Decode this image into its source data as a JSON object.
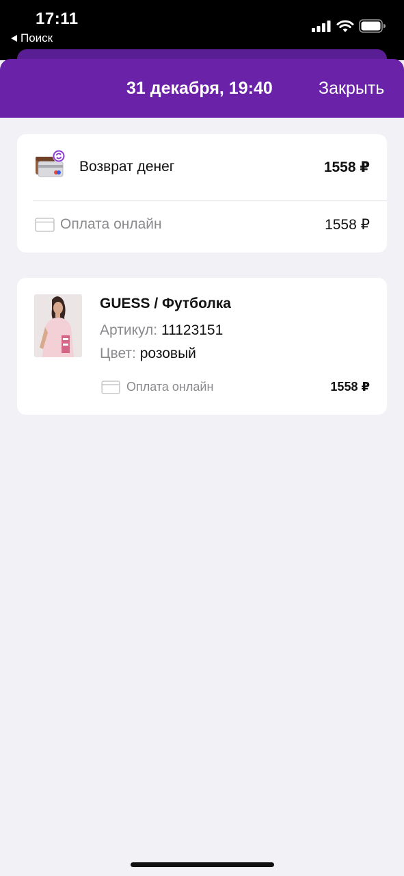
{
  "status_bar": {
    "time": "17:11",
    "back_label": "Поиск",
    "icons": [
      "signal-icon",
      "wifi-icon",
      "battery-icon"
    ]
  },
  "header": {
    "title": "31 декабря, 19:40",
    "close_label": "Закрыть"
  },
  "refund": {
    "icon": "refund-wallet-icon",
    "label": "Возврат денег",
    "amount": "1558 ₽",
    "payment_method": {
      "icon": "card-icon",
      "label": "Оплата онлайн",
      "amount": "1558 ₽"
    }
  },
  "product": {
    "image": "product-photo",
    "title": "GUESS / Футболка",
    "article_key": "Артикул:",
    "article_value": "11123151",
    "color_key": "Цвет:",
    "color_value": "розовый",
    "payment_method": {
      "icon": "card-icon",
      "label": "Оплата онлайн",
      "amount": "1558 ₽"
    }
  },
  "colors": {
    "header_purple": "#6a22a8",
    "background": "#f2f1f6",
    "secondary_text": "#8a8a8e"
  }
}
